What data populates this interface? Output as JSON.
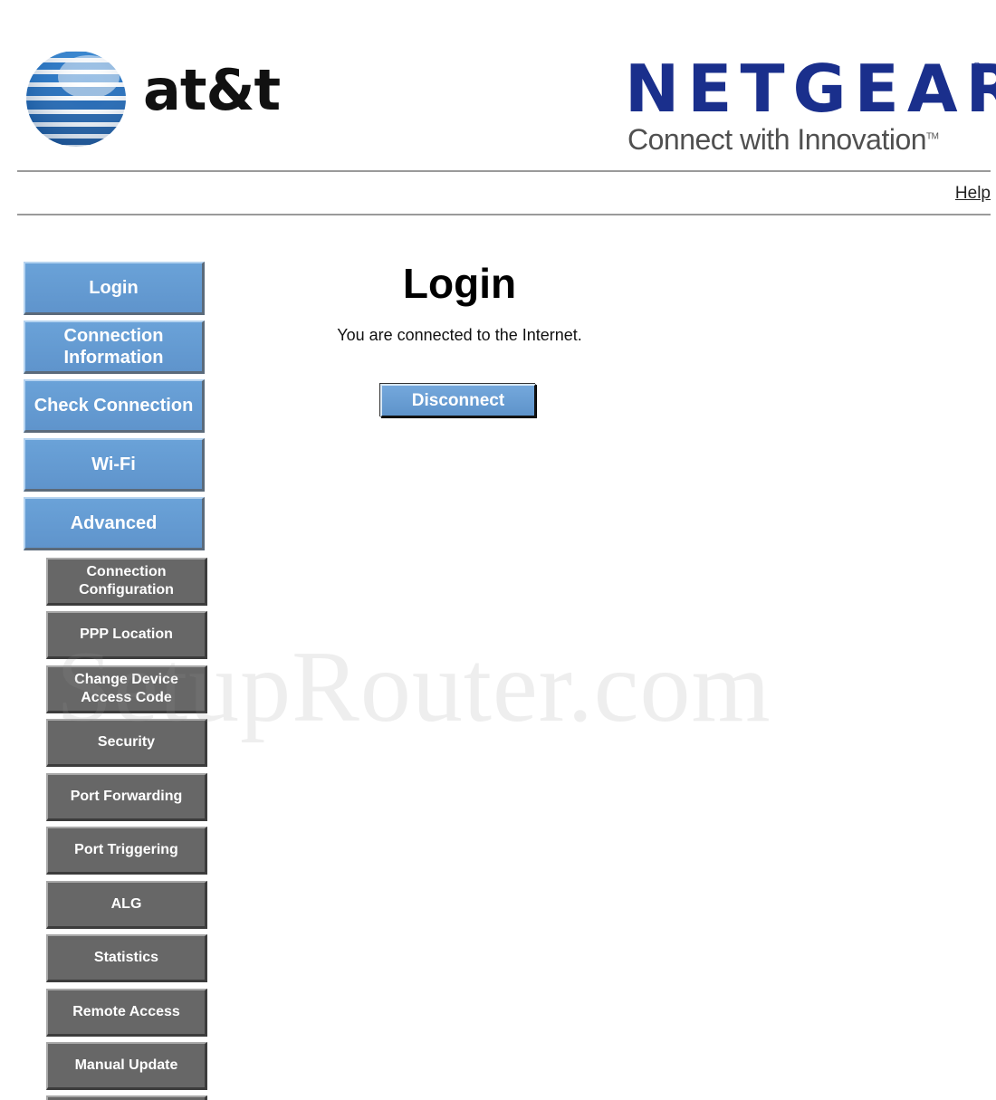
{
  "header": {
    "att_wordmark": "at&t",
    "netgear_wordmark": "NETGEAR",
    "netgear_registered": "®",
    "netgear_tagline": "Connect with Innovation",
    "netgear_trademark": "TM",
    "help_label": "Help"
  },
  "colors": {
    "primary_nav": "#6aa2d8",
    "sub_nav": "#676767",
    "netgear_brand": "#1a2f8c",
    "att_globe": "#1e72c6"
  },
  "sidebar": {
    "primary_items": [
      {
        "label": "Login"
      },
      {
        "label": "Connection Information"
      },
      {
        "label": "Check Connection"
      },
      {
        "label": "Wi-Fi"
      },
      {
        "label": "Advanced"
      }
    ],
    "advanced_items": [
      {
        "label": "Connection Configuration"
      },
      {
        "label": "PPP Location"
      },
      {
        "label": "Change Device Access Code"
      },
      {
        "label": "Security"
      },
      {
        "label": "Port Forwarding"
      },
      {
        "label": "Port Triggering"
      },
      {
        "label": "ALG"
      },
      {
        "label": "Statistics"
      },
      {
        "label": "Remote Access"
      },
      {
        "label": "Manual Update"
      }
    ]
  },
  "main": {
    "title": "Login",
    "status_message": "You are connected to the Internet.",
    "disconnect_label": "Disconnect"
  },
  "watermark": "SetupRouter.com"
}
